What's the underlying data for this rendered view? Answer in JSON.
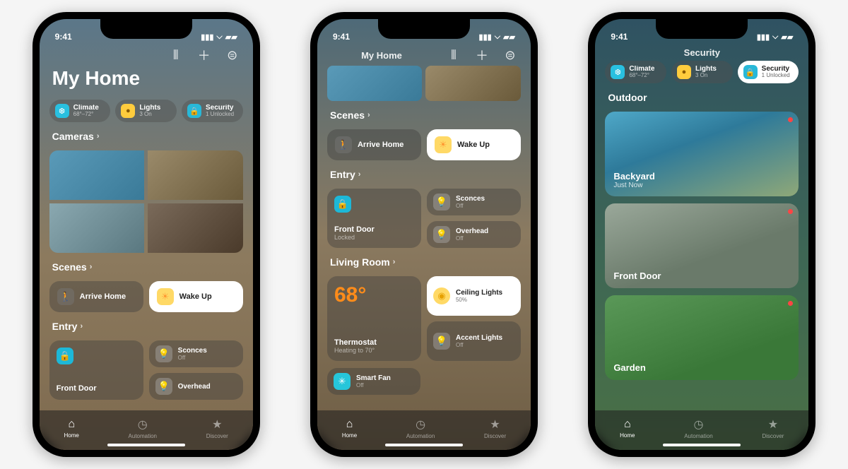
{
  "status": {
    "time": "9:41"
  },
  "tabs": {
    "home": "Home",
    "automation": "Automation",
    "discover": "Discover"
  },
  "chips": {
    "climate": {
      "label": "Climate",
      "sub": "68°–72°"
    },
    "lights": {
      "label": "Lights",
      "sub": "3 On"
    },
    "security": {
      "label": "Security",
      "sub": "1 Unlocked"
    }
  },
  "phone1": {
    "title": "My Home",
    "sec_cameras": "Cameras",
    "sec_scenes": "Scenes",
    "scene_arrive": "Arrive Home",
    "scene_wake": "Wake Up",
    "sec_entry": "Entry",
    "front_door": {
      "title": "Front Door"
    },
    "sconces": {
      "title": "Sconces",
      "sub": "Off"
    },
    "overhead": {
      "title": "Overhead"
    }
  },
  "phone2": {
    "top": "My Home",
    "sec_scenes": "Scenes",
    "scene_arrive": "Arrive Home",
    "scene_wake": "Wake Up",
    "sec_entry": "Entry",
    "front_door": {
      "title": "Front Door",
      "sub": "Locked"
    },
    "sconces": {
      "title": "Sconces",
      "sub": "Off"
    },
    "overhead": {
      "title": "Overhead",
      "sub": "Off"
    },
    "sec_living": "Living Room",
    "thermo": {
      "temp": "68°",
      "title": "Thermostat",
      "sub": "Heating to 70°"
    },
    "ceiling": {
      "title": "Ceiling Lights",
      "sub": "50%"
    },
    "accent": {
      "title": "Accent Lights",
      "sub": "Off"
    },
    "fan": {
      "title": "Smart Fan",
      "sub": "Off"
    }
  },
  "phone3": {
    "title": "Security",
    "sec_outdoor": "Outdoor",
    "cam1": {
      "title": "Backyard",
      "sub": "Just Now"
    },
    "cam2": {
      "title": "Front Door"
    },
    "cam3": {
      "title": "Garden"
    }
  }
}
